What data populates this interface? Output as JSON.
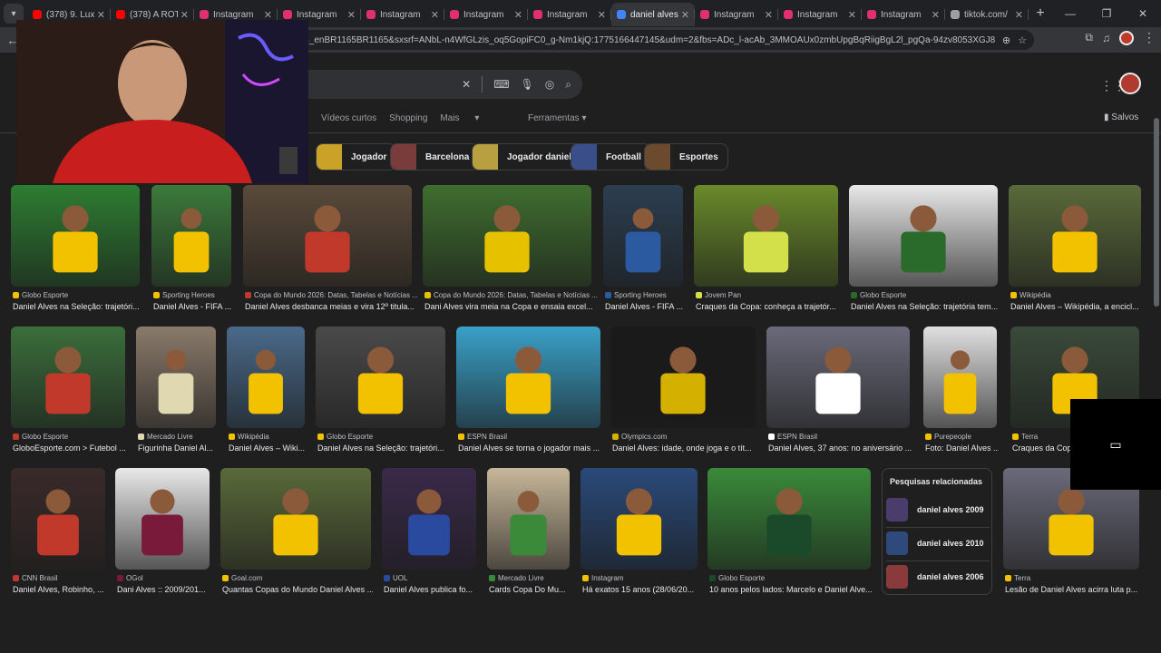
{
  "browser": {
    "tabs": [
      {
        "label": "(378) 9. Luxú",
        "icon": "youtube-icon",
        "color": "#ff0000",
        "active": false
      },
      {
        "label": "(378) A ROTI",
        "icon": "youtube-icon",
        "color": "#ff0000",
        "active": false
      },
      {
        "label": "Instagram",
        "icon": "instagram-icon",
        "color": "#e1306c",
        "active": false
      },
      {
        "label": "Instagram",
        "icon": "instagram-icon",
        "color": "#e1306c",
        "active": false
      },
      {
        "label": "Instagram",
        "icon": "instagram-icon",
        "color": "#e1306c",
        "active": false
      },
      {
        "label": "Instagram",
        "icon": "instagram-icon",
        "color": "#e1306c",
        "active": false
      },
      {
        "label": "Instagram",
        "icon": "instagram-icon",
        "color": "#e1306c",
        "active": false
      },
      {
        "label": "daniel alves",
        "icon": "google-icon",
        "color": "#4285f4",
        "active": true
      },
      {
        "label": "Instagram",
        "icon": "instagram-icon",
        "color": "#e1306c",
        "active": false
      },
      {
        "label": "Instagram",
        "icon": "instagram-icon",
        "color": "#e1306c",
        "active": false
      },
      {
        "label": "Instagram",
        "icon": "instagram-icon",
        "color": "#e1306c",
        "active": false
      },
      {
        "label": "tiktok.com/",
        "icon": "globe-icon",
        "color": "#9aa0a6",
        "active": false
      }
    ],
    "new_tab": "+",
    "url": "1VDKB_enBR1165BR1165&sxsrf=ANbL-n4WfGLzis_oq5GopiFC0_g-Nm1kjQ:1775166447145&udm=2&fbs=ADc_l-acAb_3MMOAUx0zmbUpgBqRiigBgL2l_pgQa-94zv8053XGJ8j52MAaeNc..."
  },
  "google": {
    "filters": [
      "Vídeos curtos",
      "Shopping",
      "Mais"
    ],
    "tools": "Ferramentas",
    "saved": "Salvos",
    "chips": [
      {
        "label": "Jogador",
        "color": "#c9a227"
      },
      {
        "label": "Barcelona",
        "color": "#7a3b3b"
      },
      {
        "label": "Jogador daniel",
        "color": "#b8a040"
      },
      {
        "label": "Football",
        "color": "#3a4f8a"
      },
      {
        "label": "Esportes",
        "color": "#6b4a2e"
      }
    ],
    "related": {
      "title": "Pesquisas relacionadas",
      "items": [
        {
          "label": "daniel alves 2009",
          "color": "#4a3c6b"
        },
        {
          "label": "daniel alves 2010",
          "color": "#2e4a7a"
        },
        {
          "label": "daniel alves 2006",
          "color": "#8a3a3a"
        }
      ]
    },
    "results": [
      {
        "source": "Globo Esporte",
        "caption": "Daniel Alves na Seleção: trajetóri...",
        "color": "#2e7d32",
        "accent": "#f2c200"
      },
      {
        "source": "Sporting Heroes",
        "caption": "Daniel Alves - FIFA ...",
        "color": "#3b7a3b",
        "accent": "#f2c200"
      },
      {
        "source": "Copa do Mundo 2026: Datas, Tabelas e Notícias ...",
        "caption": "Daniel Alves desbanca meias e vira 12º titula...",
        "color": "#5a4a3a",
        "accent": "#c0392b"
      },
      {
        "source": "Copa do Mundo 2026: Datas, Tabelas e Notícias ...",
        "caption": "Dani Alves vira meia na Copa e ensaia excel...",
        "color": "#3f6e2f",
        "accent": "#e5c100"
      },
      {
        "source": "Sporting Heroes",
        "caption": "Daniel Alves - FIFA ...",
        "color": "#2c3e50",
        "accent": "#2c5aa0"
      },
      {
        "source": "Jovem Pan",
        "caption": "Craques da Copa: conheça a trajetór...",
        "color": "#6a8a2a",
        "accent": "#d4e04a"
      },
      {
        "source": "Globo Esporte",
        "caption": "Daniel Alves na Seleção: trajetória tem...",
        "color": "#e8e8e8",
        "accent": "#2a6a2a"
      },
      {
        "source": "Wikipédia",
        "caption": "Daniel Alves – Wikipédia, a encicl...",
        "color": "#5a6a3a",
        "accent": "#f2c200"
      },
      {
        "source": "Globo Esporte",
        "caption": "GloboEsporte.com > Futebol ...",
        "color": "#3b6e3b",
        "accent": "#c0392b"
      },
      {
        "source": "Mercado Livre",
        "caption": "Figurinha Daniel Al...",
        "color": "#8a7a6a",
        "accent": "#e0d8b0"
      },
      {
        "source": "Wikipédia",
        "caption": "Daniel Alves – Wiki...",
        "color": "#4a6a8a",
        "accent": "#f2c200"
      },
      {
        "source": "Globo Esporte",
        "caption": "Daniel Alves na Seleção: trajetóri...",
        "color": "#4a4a4a",
        "accent": "#f2c200"
      },
      {
        "source": "ESPN Brasil",
        "caption": "Daniel Alves se torna o jogador mais ...",
        "color": "#3aa0c8",
        "accent": "#f2c200"
      },
      {
        "source": "Olympics.com",
        "caption": "Daniel Alves: idade, onde joga e o tít...",
        "color": "#1a1a1a",
        "accent": "#d4b000"
      },
      {
        "source": "ESPN Brasil",
        "caption": "Daniel Alves, 37 anos: no aniversário ...",
        "color": "#6a6a7a",
        "accent": "#ffffff"
      },
      {
        "source": "Purepeople",
        "caption": "Foto: Daniel Alves ...",
        "color": "#e0e0e0",
        "accent": "#f2c200"
      },
      {
        "source": "Terra",
        "caption": "Craques da Cop...",
        "color": "#3a4a3a",
        "accent": "#f2c200"
      },
      {
        "source": "CNN Brasil",
        "caption": "Daniel Alves, Robinho, ...",
        "color": "#3a2a2a",
        "accent": "#c0392b"
      },
      {
        "source": "OGol",
        "caption": "Dani Alves :: 2009/201...",
        "color": "#e8e8e8",
        "accent": "#7a1a3a"
      },
      {
        "source": "Goal.com",
        "caption": "Quantas Copas do Mundo Daniel Alves ...",
        "color": "#5a6a3a",
        "accent": "#f2c200"
      },
      {
        "source": "UOL",
        "caption": "Daniel Alves publica fo...",
        "color": "#3a2a4a",
        "accent": "#2a4aa0"
      },
      {
        "source": "Mercado Livre",
        "caption": "Cards Copa Do Mu...",
        "color": "#c8b89a",
        "accent": "#3a8a3a"
      },
      {
        "source": "Instagram",
        "caption": "Há exatos 15 anos (28/06/20...",
        "color": "#2a4a7a",
        "accent": "#f2c200"
      },
      {
        "source": "Globo Esporte",
        "caption": "10 anos pelos lados: Marcelo e Daniel Alve...",
        "color": "#3a8a3a",
        "accent": "#1a4a2a"
      },
      {
        "source": "Terra",
        "caption": "Lesão de Daniel Alves acirra luta p...",
        "color": "#6a6a7a",
        "accent": "#f2c200"
      }
    ]
  }
}
